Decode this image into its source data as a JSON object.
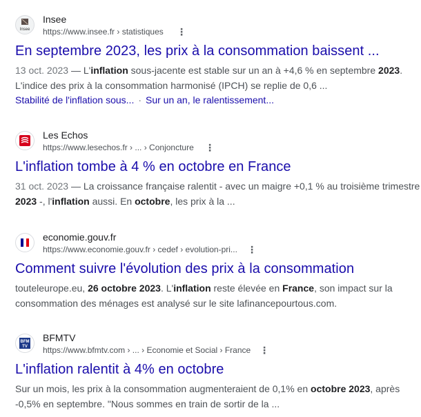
{
  "results": [
    {
      "site": "Insee",
      "url": "https://www.insee.fr",
      "crumbs": " › statistiques",
      "title": "En septembre 2023, les prix à la consommation baissent ...",
      "date": "13 oct. 2023",
      "dash": " — ",
      "snippet1_a": "L'",
      "snippet1_b": "inflation",
      "snippet1_c": " sous-jacente est stable sur un an à +4,6 % en septembre ",
      "snippet1_d": "2023",
      "snippet1_e": ".",
      "snippet2": "L'indice des prix à la consommation harmonisé (IPCH) se replie de 0,6 ...",
      "sitelink1": "Stabilité de l'inflation sous...",
      "sitelink_sep": "·",
      "sitelink2": "Sur un an, le ralentissement...",
      "favicon_text": "Insee"
    },
    {
      "site": "Les Echos",
      "url": "https://www.lesechos.fr",
      "crumbs": " › ... › Conjoncture",
      "title": "L'inflation tombe à 4 % en octobre en France",
      "date": "31 oct. 2023",
      "dash": " — ",
      "snippet1": "La croissance française ralentit - avec un maigre +0,1 % au troisième trimestre",
      "snippet2_a": "2023",
      "snippet2_b": " -, l'",
      "snippet2_c": "inflation",
      "snippet2_d": " aussi. En ",
      "snippet2_e": "octobre",
      "snippet2_f": ", les prix à la ..."
    },
    {
      "site": "economie.gouv.fr",
      "url": "https://www.economie.gouv.fr",
      "crumbs": " › cedef › evolution-pri...",
      "title": "Comment suivre l'évolution des prix à la consommation",
      "snippet1_a": "touteleurope.eu, ",
      "snippet1_b": "26 octobre 2023",
      "snippet1_c": ". L'",
      "snippet1_d": "inflation",
      "snippet1_e": " reste élevée en ",
      "snippet1_f": "France",
      "snippet1_g": ", son impact sur la",
      "snippet2": "consommation des ménages est analysé sur le site lafinancepourtous.com."
    },
    {
      "site": "BFMTV",
      "url": "https://www.bfmtv.com",
      "crumbs": " › ... › Economie et Social › France",
      "title": "L'inflation ralentit à 4% en octobre",
      "snippet1_a": "Sur un mois, les prix à la consommation augmenteraient de 0,1% en ",
      "snippet1_b": "octobre 2023",
      "snippet1_c": ", après",
      "snippet2": "-0,5% en septembre. \"Nous sommes en train de sortir de la ...",
      "favicon_text": "BFM TV"
    }
  ],
  "menu_glyph": "⋮"
}
